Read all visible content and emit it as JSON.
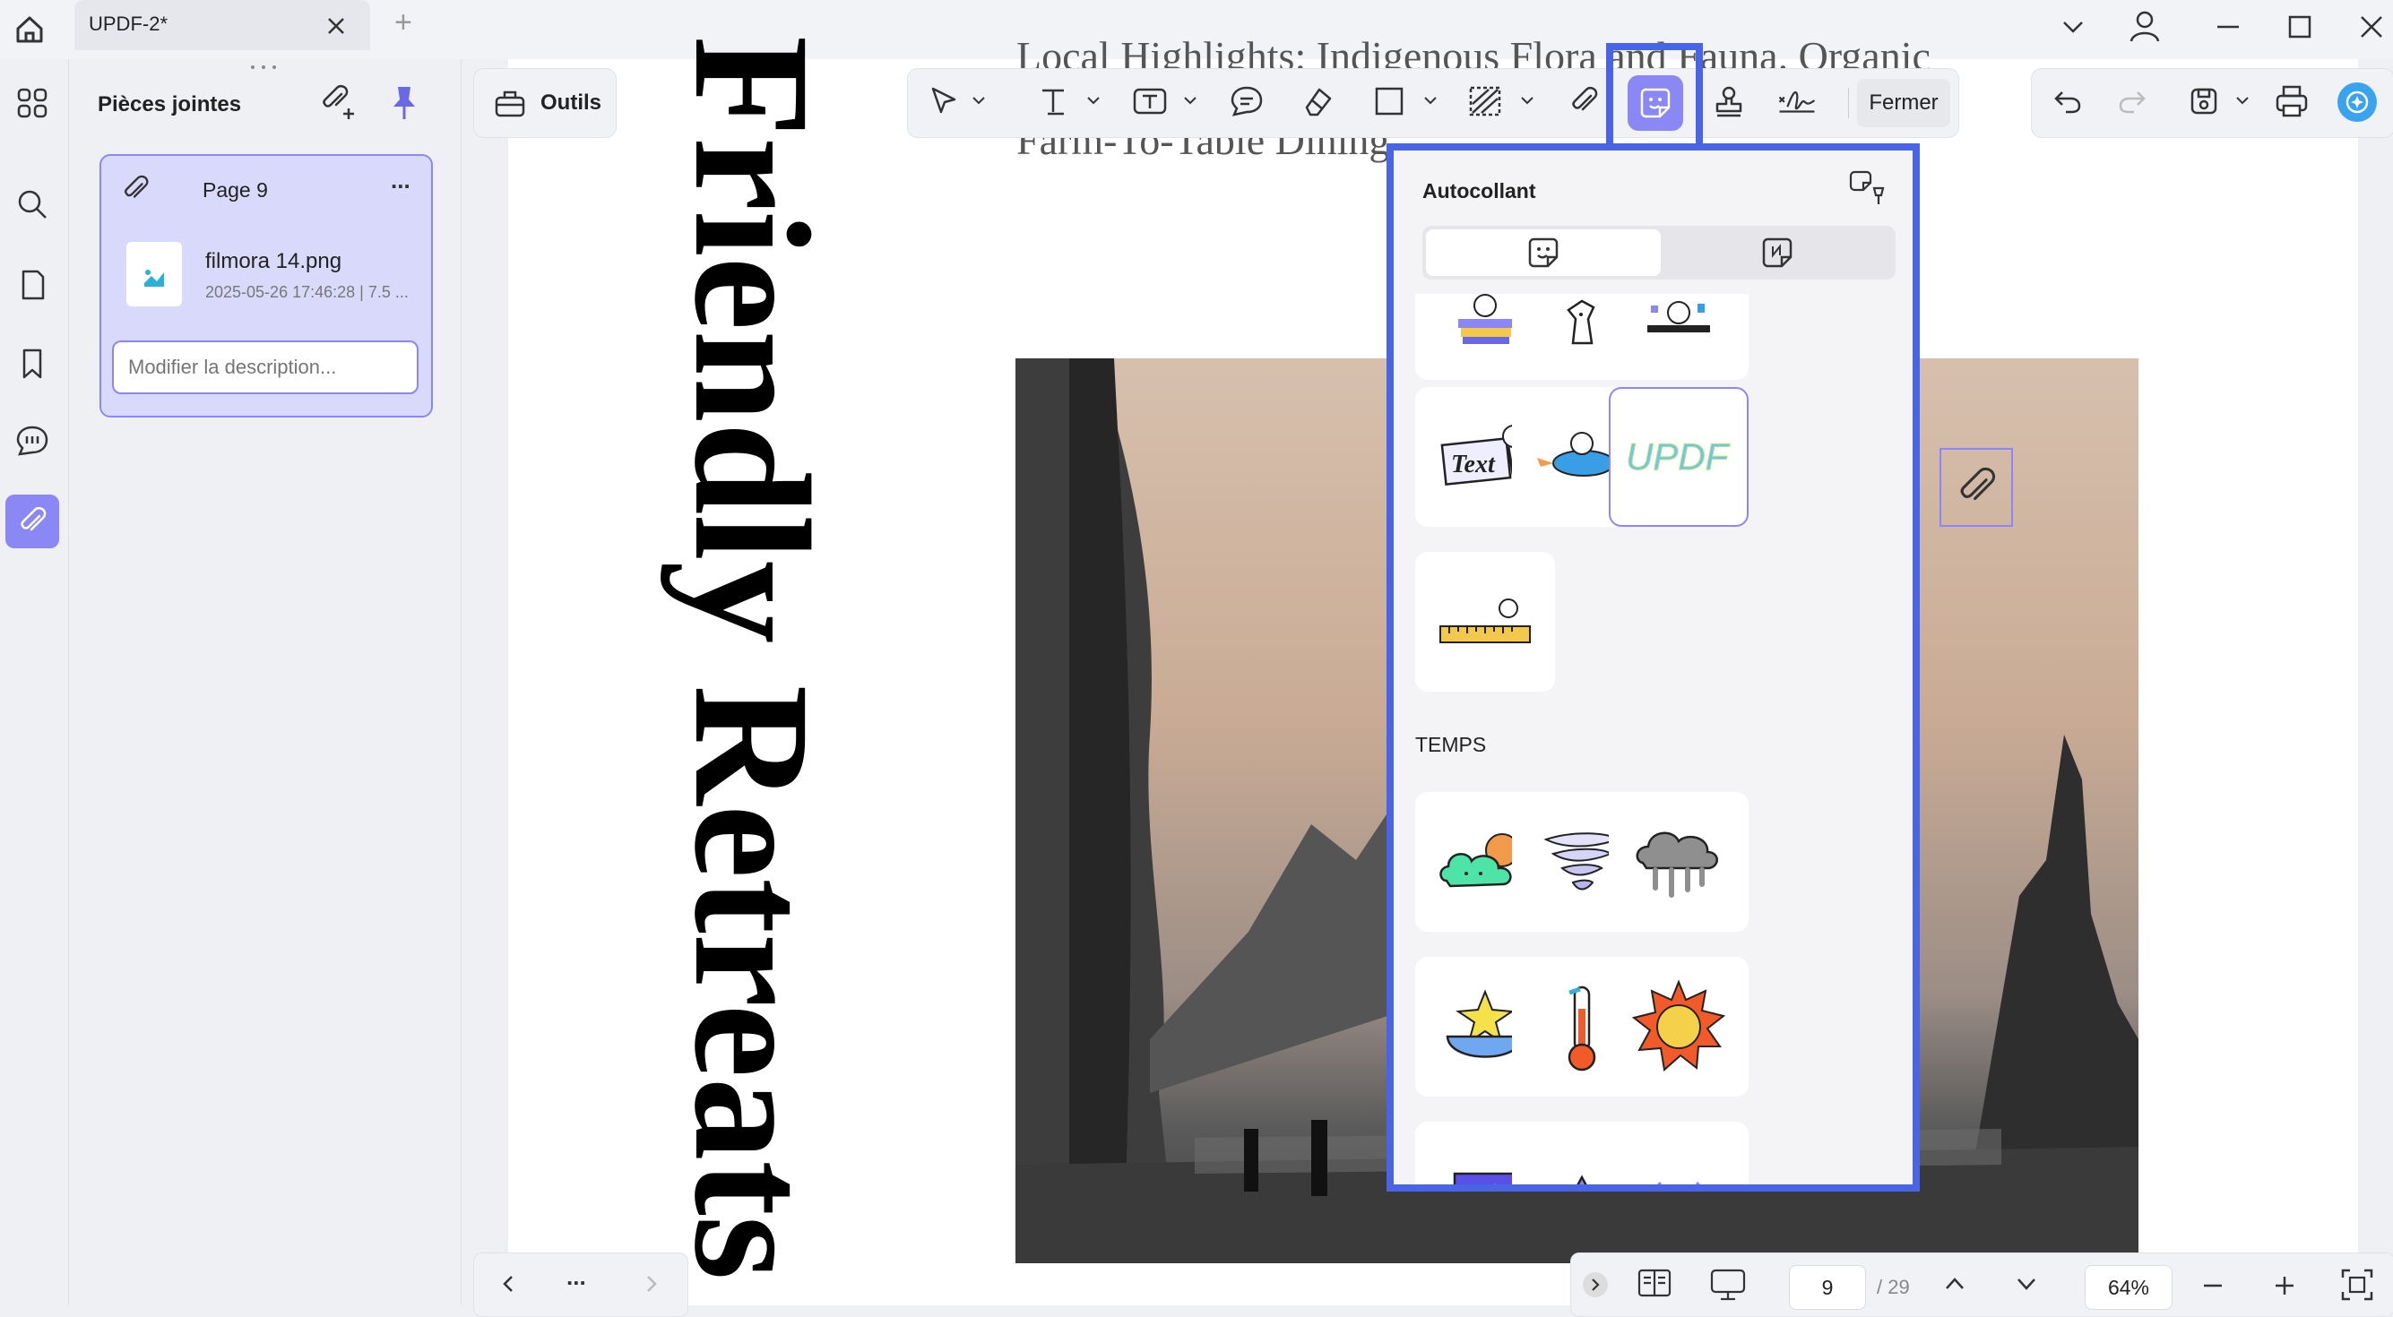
{
  "window": {
    "tab_title": "UPDF-2*",
    "new_tab_symbol": "+"
  },
  "attachments_panel": {
    "title": "Pièces jointes",
    "item": {
      "page_label": "Page 9",
      "file_name": "filmora 14.png",
      "file_meta": "2025-05-26 17:46:28 | 7.5 ...",
      "description_placeholder": "Modifier la description...",
      "more_symbol": "..."
    }
  },
  "toolbar": {
    "tools_label": "Outils",
    "close_label": "Fermer"
  },
  "document": {
    "vertical_title": "Friendly Retreats",
    "top_line_1": "Local Highlights: Indigenous Flora and Fauna. Organic",
    "top_line_2": "Farm-To-Table Dining"
  },
  "sticker_panel": {
    "title": "Autocollant",
    "section_weather": "TEMPS",
    "updf_sticker_text": "UPDF",
    "text_sticker_text": "Text"
  },
  "bottom_bar": {
    "current_page": "9",
    "total_pages": "/ 29",
    "zoom": "64%",
    "more_symbol": "..."
  },
  "colors": {
    "accent": "#8b88f6",
    "highlight": "#4a64e6"
  }
}
